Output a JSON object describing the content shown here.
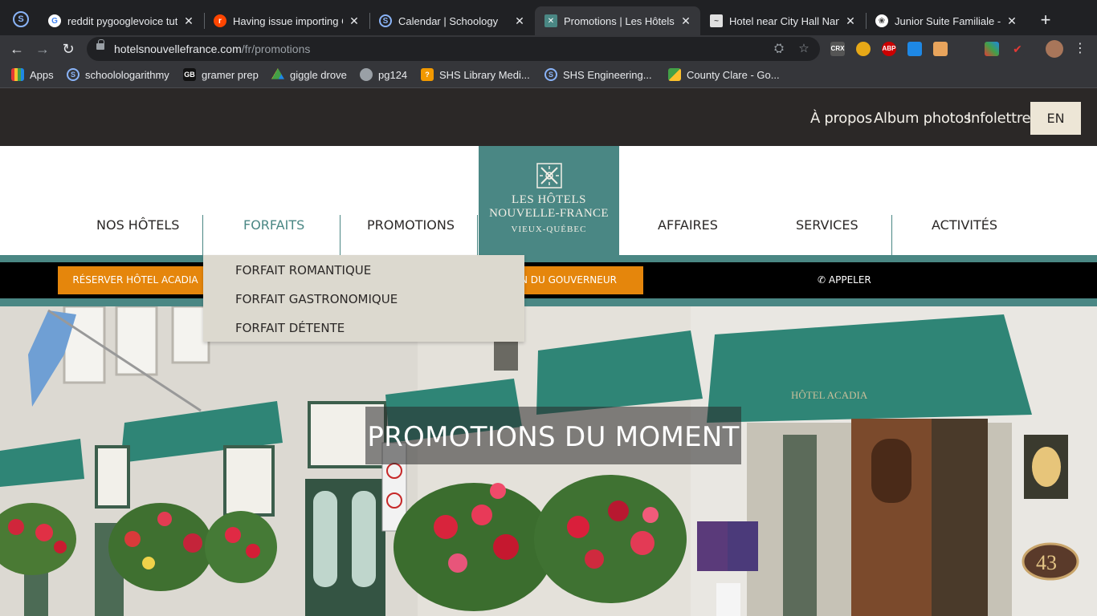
{
  "browser": {
    "tabs": [
      {
        "title": "reddit pygooglevoice tuto",
        "icon": "google-icon",
        "color": "#ffffff"
      },
      {
        "title": "Having issue importing G",
        "icon": "reddit-icon",
        "color": "#ff4500"
      },
      {
        "title": "Calendar | Schoology",
        "icon": "schoology-icon",
        "color": "#1e88e5"
      },
      {
        "title": "Promotions | Les Hôtels N",
        "icon": "hotel-logo-icon",
        "color": "#4a8784"
      },
      {
        "title": "Hotel near City Hall Nant",
        "icon": "page-icon",
        "color": "#dddddd"
      },
      {
        "title": "Junior Suite Familiale - H",
        "icon": "paw-icon",
        "color": "#ffffff"
      }
    ],
    "url_host": "hotelsnouvellefrance.com",
    "url_path": "/fr/promotions",
    "bookmarks": [
      {
        "label": "Apps",
        "icon": "apps-grid-icon"
      },
      {
        "label": "schoolologarithmy",
        "icon": "schoology-icon"
      },
      {
        "label": "gramer prep",
        "icon": "gb-icon"
      },
      {
        "label": "giggle drove",
        "icon": "google-drive-icon"
      },
      {
        "label": "pg124",
        "icon": "globe-icon"
      },
      {
        "label": "SHS Library Medi...",
        "icon": "library-icon"
      },
      {
        "label": "SHS Engineering...",
        "icon": "schoology-icon"
      },
      {
        "label": "County Clare - Go...",
        "icon": "maps-icon"
      }
    ],
    "extensions": [
      "CRX",
      "ABP"
    ]
  },
  "site": {
    "top_links": {
      "about": "À propos",
      "album": "Album photos",
      "newsletter": "Infolettre",
      "lang": "EN"
    },
    "nav": {
      "hotels": "NOS HÔTELS",
      "packages": "FORFAITS",
      "promotions": "PROMOTIONS",
      "business": "AFFAIRES",
      "services": "SERVICES",
      "activities": "ACTIVITÉS"
    },
    "logo": {
      "line1": "LES HÔTELS",
      "line2": "NOUVELLE-FRANCE",
      "line3": "VIEUX-QUÉBEC"
    },
    "booking": {
      "acadia": "RÉSERVER HÔTEL ACADIA",
      "gouverneur": "N DU GOUVERNEUR",
      "call": "APPELER"
    },
    "dropdown": [
      "FORFAIT ROMANTIQUE",
      "FORFAIT GASTRONOMIQUE",
      "FORFAIT DÉTENTE"
    ],
    "hero": {
      "title": "PROMOTIONS DU MOMENT",
      "awning_text": "HÔTEL ACADIA",
      "door_number": "43"
    },
    "colors": {
      "teal": "#4a8784",
      "orange": "#e5860c",
      "dark": "#2b2827",
      "cream": "#ede6d6"
    }
  }
}
